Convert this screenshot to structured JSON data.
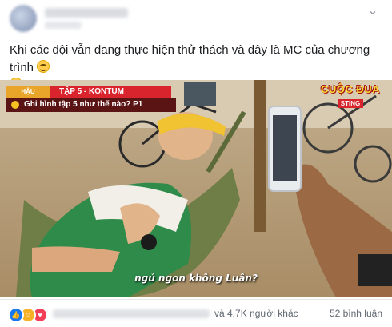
{
  "post": {
    "more_icon": "more-horizontal-icon",
    "caption": "Khi các đội vẫn đang thực hiện thử thách và đây là MC của chương trình"
  },
  "image": {
    "tag_category": "HẬU TRƯỜNG",
    "tag_episode": "TẬP 5 - KONTUM",
    "tag_question": "Ghi hình tập 5 như thế nào? P1",
    "brand_title": "CUỘC ĐUA",
    "brand_sub": "STING",
    "subtitle": "ngủ ngon không Luân?"
  },
  "footer": {
    "reactions": [
      "like-icon",
      "haha-icon",
      "love-icon"
    ],
    "others_text": "và 4,7K người khác",
    "comments_text": "52 bình luận"
  },
  "colors": {
    "facebook_blue": "#1877f2",
    "badge_red": "#d9232d",
    "badge_orange": "#e8a52a"
  }
}
